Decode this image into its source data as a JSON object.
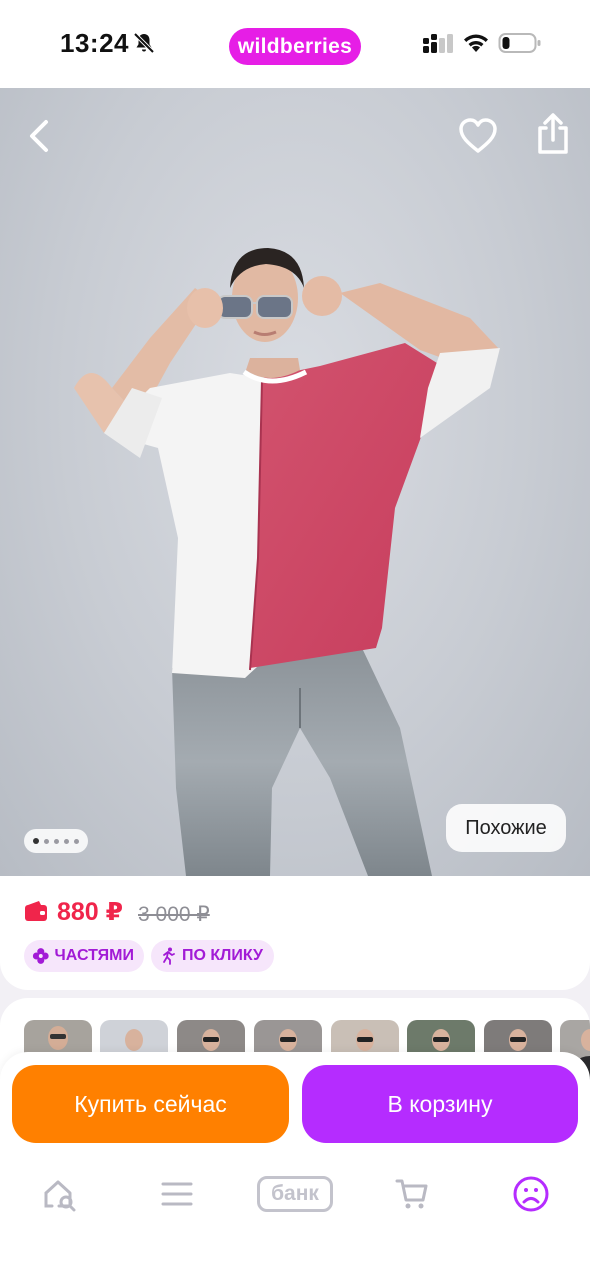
{
  "status_bar": {
    "time": "13:24",
    "brand": "wildberries",
    "icons": [
      "bell-off-icon",
      "signal-icon",
      "wifi-icon",
      "battery-icon"
    ]
  },
  "product_gallery": {
    "image_count": 5,
    "active_image": 1,
    "similar_label": "Похожие",
    "icons": [
      "chevron-left-icon",
      "heart-icon",
      "share-icon"
    ]
  },
  "pricing": {
    "price": "880 ₽",
    "old_price": "3 000 ₽",
    "price_color": "#f0254b",
    "tags": [
      {
        "label": "ЧАСТЯМИ",
        "icon": "flower-icon"
      },
      {
        "label": "ПО КЛИКУ",
        "icon": "running-person-icon"
      }
    ]
  },
  "thumbnails": {
    "count": 8
  },
  "actions": {
    "buy_now": "Купить сейчас",
    "add_to_cart": "В корзину",
    "buy_color": "#ff8000",
    "cart_color": "#b52cff"
  },
  "bottom_nav": {
    "bank_label": "банк",
    "items": [
      "home-search-icon",
      "menu-icon",
      "bank",
      "cart-icon",
      "profile-icon"
    ],
    "active": "profile-icon"
  }
}
